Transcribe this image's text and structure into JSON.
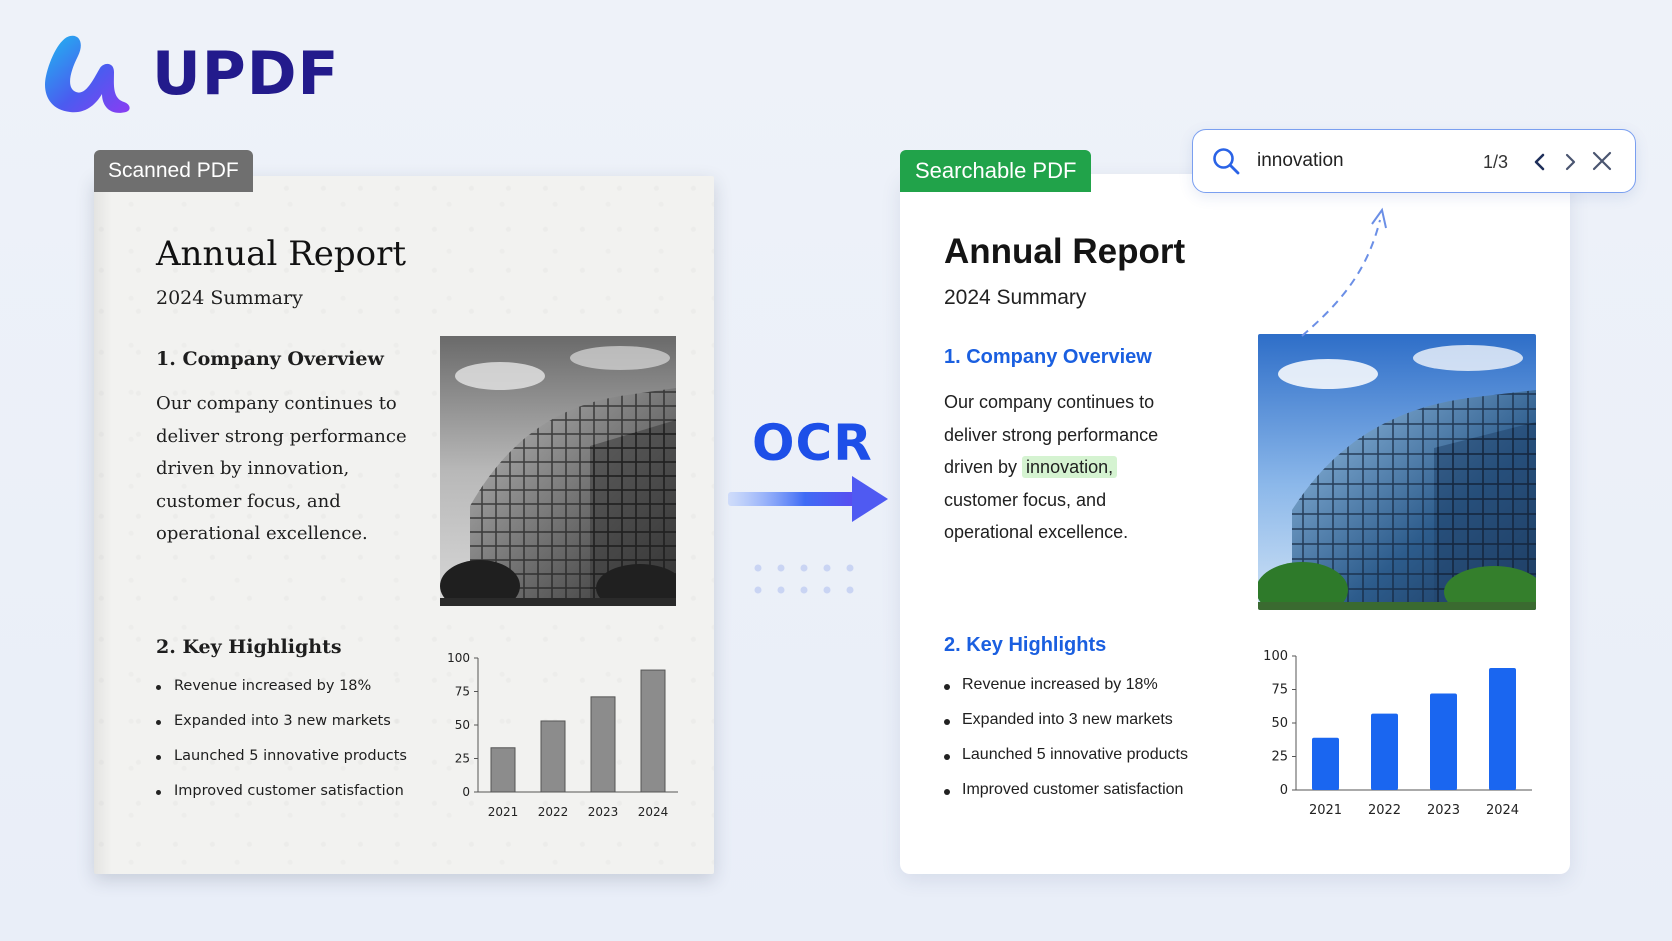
{
  "brand": {
    "name": "UPDF"
  },
  "scanned": {
    "tag": "Scanned PDF",
    "title": "Annual Report",
    "subtitle": "2024 Summary",
    "section1": "1. Company Overview",
    "paragraph_lines": [
      "Our company continues to",
      "deliver strong performance",
      "driven by innovation,",
      "customer focus, and",
      "operational excellence."
    ],
    "section2": "2. Key Highlights",
    "highlights": [
      "Revenue increased by 18%",
      "Expanded into 3 new markets",
      "Launched 5 innovative products",
      "Improved customer satisfaction"
    ]
  },
  "ocr": {
    "label": "OCR"
  },
  "searchable": {
    "tag": "Searchable PDF",
    "title": "Annual Report",
    "subtitle": "2024 Summary",
    "section1": "1. Company Overview",
    "para_line1": "Our company continues to",
    "para_line2": "deliver strong performance",
    "para_line3_pre": "driven by ",
    "para_line3_hit": "innovation,",
    "para_line4": "customer focus, and",
    "para_line5": "operational excellence.",
    "section2": "2. Key Highlights",
    "highlights": [
      "Revenue increased by 18%",
      "Expanded into 3 new markets",
      "Launched 5 innovative products",
      "Improved customer satisfaction"
    ]
  },
  "search": {
    "query": "innovation",
    "count": "1/3",
    "icons": {
      "search": "search-icon",
      "prev": "chevron-left-icon",
      "next": "chevron-right-icon",
      "close": "close-icon"
    }
  },
  "colors": {
    "brand_navy": "#231b8c",
    "ocr_blue": "#1d4fe8",
    "bar_blue": "#1a66f0",
    "scan_bar": "#8a8a8a",
    "tag_green": "#21a34a",
    "tag_gray": "#6f6f6f",
    "highlight": "#d5f3d1",
    "heading_blue": "#1a5fe0"
  },
  "chart_data": [
    {
      "type": "bar",
      "categories": [
        "2021",
        "2022",
        "2023",
        "2024"
      ],
      "values": [
        33,
        53,
        71,
        91
      ],
      "yticks": [
        "0",
        "25",
        "50",
        "75",
        "100"
      ],
      "ylim": [
        0,
        100
      ],
      "style": "scanned"
    },
    {
      "type": "bar",
      "categories": [
        "2021",
        "2022",
        "2023",
        "2024"
      ],
      "values": [
        39,
        57,
        72,
        91
      ],
      "yticks": [
        "0",
        "25",
        "50",
        "75",
        "100"
      ],
      "ylim": [
        0,
        100
      ],
      "style": "color"
    }
  ]
}
